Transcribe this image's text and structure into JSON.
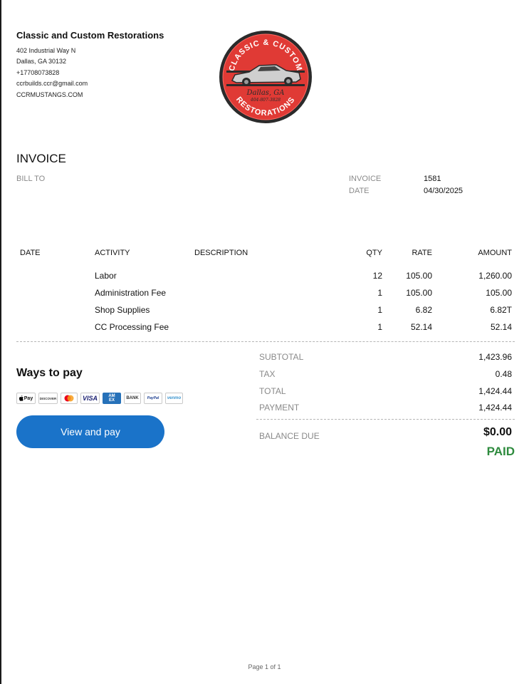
{
  "company": {
    "name": "Classic and Custom Restorations",
    "address_line1": "402 Industrial Way N",
    "address_line2": "Dallas, GA  30132",
    "phone": "+17708073828",
    "email": "ccrbuilds.ccr@gmail.com",
    "website": "CCRMUSTANGS.COM"
  },
  "logo": {
    "top_text": "CLASSIC & CUSTOM",
    "city": "Dallas, GA",
    "phone": "404-807-3828",
    "bottom_text": "RESTORATIONS",
    "colors": {
      "ring": "#2b2b2b",
      "fill": "#e03a35"
    }
  },
  "invoice": {
    "title": "INVOICE",
    "bill_to_label": "BILL TO",
    "number_label": "INVOICE",
    "number": "1581",
    "date_label": "DATE",
    "date": "04/30/2025"
  },
  "table": {
    "headers": {
      "date": "DATE",
      "activity": "ACTIVITY",
      "description": "DESCRIPTION",
      "qty": "QTY",
      "rate": "RATE",
      "amount": "AMOUNT"
    },
    "rows": [
      {
        "activity": "Labor",
        "qty": "12",
        "rate": "105.00",
        "amount": "1,260.00"
      },
      {
        "activity": "Administration Fee",
        "qty": "1",
        "rate": "105.00",
        "amount": "105.00"
      },
      {
        "activity": "Shop Supplies",
        "qty": "1",
        "rate": "6.82",
        "amount": "6.82T"
      },
      {
        "activity": "CC Processing Fee",
        "qty": "1",
        "rate": "52.14",
        "amount": "52.14"
      }
    ]
  },
  "totals": {
    "subtotal_label": "SUBTOTAL",
    "subtotal": "1,423.96",
    "tax_label": "TAX",
    "tax": "0.48",
    "total_label": "TOTAL",
    "total": "1,424.44",
    "payment_label": "PAYMENT",
    "payment": "1,424.44",
    "balance_label": "BALANCE DUE",
    "balance": "$0.00",
    "status": "PAID",
    "status_color": "#2e8b3e"
  },
  "payment": {
    "title": "Ways to pay",
    "methods": [
      "Pay",
      "DISCOVER",
      "",
      "VISA",
      "AM EX",
      "BANK",
      "PayPal",
      "venmo"
    ],
    "button_label": "View and pay",
    "button_color": "#1a73c9"
  },
  "footer": {
    "page": "Page 1 of 1"
  }
}
